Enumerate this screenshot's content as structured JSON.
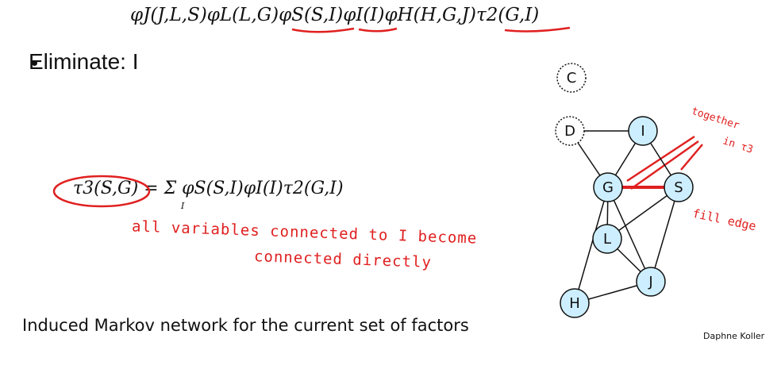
{
  "top_formula": "φJ(J,L,S)φL(L,G)φS(S,I)φI(I)φH(H,G,J)τ2(G,I)",
  "bullet_text": "Eliminate: I",
  "sum_formula": "τ3(S,G) = Σ φS(S,I)φI(I)τ2(G,I)",
  "sum_index": "I",
  "handwritten": {
    "note_line1": "all variables connected to I become",
    "note_line2": "connected directly",
    "together_line1": "together",
    "together_line2": "in τ3",
    "fill_edge": "fill edge"
  },
  "caption": "Induced Markov network for the current set of factors",
  "credit": "Daphne Koller",
  "graph": {
    "nodes": [
      {
        "id": "C",
        "label": "C",
        "eliminated": true
      },
      {
        "id": "D",
        "label": "D",
        "eliminated": true
      },
      {
        "id": "I",
        "label": "I",
        "eliminated": false
      },
      {
        "id": "G",
        "label": "G",
        "eliminated": false
      },
      {
        "id": "S",
        "label": "S",
        "eliminated": false
      },
      {
        "id": "L",
        "label": "L",
        "eliminated": false
      },
      {
        "id": "J",
        "label": "J",
        "eliminated": false
      },
      {
        "id": "H",
        "label": "H",
        "eliminated": false
      }
    ],
    "edges": [
      [
        "D",
        "I"
      ],
      [
        "D",
        "G"
      ],
      [
        "I",
        "G"
      ],
      [
        "I",
        "S"
      ],
      [
        "G",
        "L"
      ],
      [
        "G",
        "J"
      ],
      [
        "G",
        "H"
      ],
      [
        "S",
        "L"
      ],
      [
        "S",
        "J"
      ],
      [
        "L",
        "J"
      ],
      [
        "H",
        "J"
      ]
    ],
    "fill_edges": [
      [
        "G",
        "S"
      ]
    ],
    "node_fill": "#cceeff",
    "eliminated_fill": "#ffffff"
  },
  "colors": {
    "annotation": "#e02020",
    "text": "#111111"
  }
}
